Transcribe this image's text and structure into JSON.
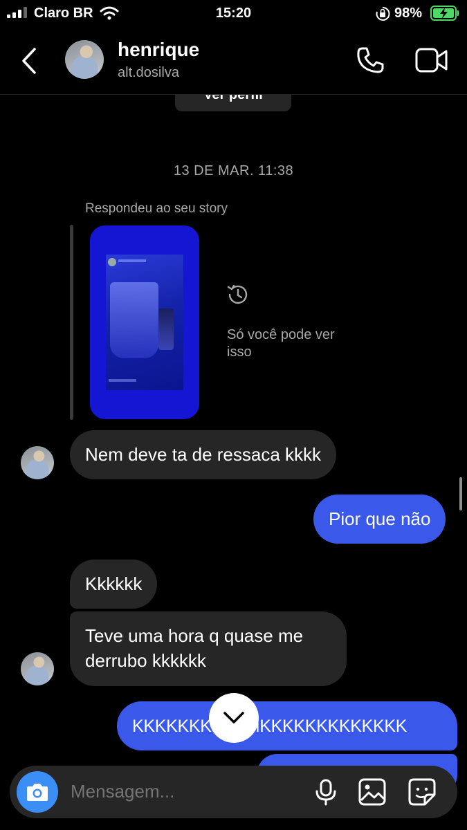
{
  "status_bar": {
    "carrier": "Claro BR",
    "time": "15:20",
    "battery": "98%"
  },
  "header": {
    "name": "henrique",
    "handle": "alt.dosilva"
  },
  "ver_perfil": "Ver perfil",
  "date_separator": "13 DE MAR. 11:38",
  "story_reply": {
    "label": "Respondeu ao seu story",
    "only_you": "Só você pode ver isso"
  },
  "messages": [
    {
      "from": "them",
      "text": "Nem deve ta de ressaca kkkk"
    },
    {
      "from": "me",
      "text": "Pior que não"
    },
    {
      "from": "them",
      "text": "Kkkkkk"
    },
    {
      "from": "them",
      "text": "Teve uma hora q quase me derrubo kkkkkk"
    },
    {
      "from": "me",
      "text": "KKKKKKKKKKMKKKKKKKKKKKKK"
    }
  ],
  "composer": {
    "placeholder": "Mensagem..."
  },
  "icons": [
    "back-icon",
    "phone-icon",
    "video-icon",
    "history-icon",
    "chevron-down-icon",
    "camera-icon",
    "microphone-icon",
    "gallery-icon",
    "sticker-icon"
  ],
  "colors": {
    "outgoing_bubble": "#3a59ea",
    "incoming_bubble": "#262626",
    "camera_button": "#3a8ef6",
    "story_card": "#1515d4"
  }
}
